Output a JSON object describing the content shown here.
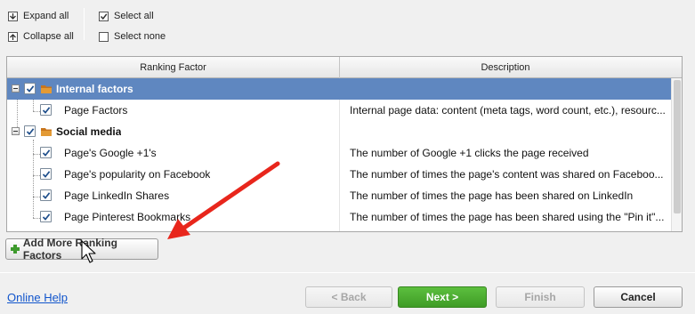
{
  "toolbar": {
    "expand_all": "Expand all",
    "collapse_all": "Collapse all",
    "select_all": "Select all",
    "select_none": "Select none"
  },
  "grid": {
    "columns": [
      "Ranking Factor",
      "Description"
    ],
    "rows": [
      {
        "name": "Internal factors",
        "description": "",
        "type": "group",
        "checked": true,
        "selected": true
      },
      {
        "name": "Page Factors",
        "description": "Internal page data: content (meta tags, word count, etc.), resourc...",
        "type": "item",
        "checked": true
      },
      {
        "name": "Social media",
        "description": "",
        "type": "group",
        "checked": true
      },
      {
        "name": "Page's Google +1's",
        "description": "The number of Google +1 clicks the page received",
        "type": "item",
        "checked": true
      },
      {
        "name": "Page's popularity on Facebook",
        "description": "The number of times the page's content was shared on Faceboo...",
        "type": "item",
        "checked": true
      },
      {
        "name": "Page LinkedIn Shares",
        "description": "The number of times the page has been shared on LinkedIn",
        "type": "item",
        "checked": true
      },
      {
        "name": "Page Pinterest Bookmarks",
        "description": "The number of times the page has been shared using the \"Pin it\"...",
        "type": "item",
        "checked": true
      }
    ]
  },
  "add_button": "Add More Ranking Factors",
  "footer": {
    "help": "Online Help",
    "back": "< Back",
    "next": "Next >",
    "finish": "Finish",
    "cancel": "Cancel"
  },
  "colors": {
    "selection": "#5f87c0",
    "primary": "#4aad2f",
    "arrow": "#e8261c",
    "link": "#1155cc"
  },
  "icons": [
    "expand-all-icon",
    "collapse-all-icon",
    "checkbox-icon",
    "folder-icon",
    "plus-icon",
    "red-arrow-annotation",
    "mouse-cursor-icon"
  ]
}
